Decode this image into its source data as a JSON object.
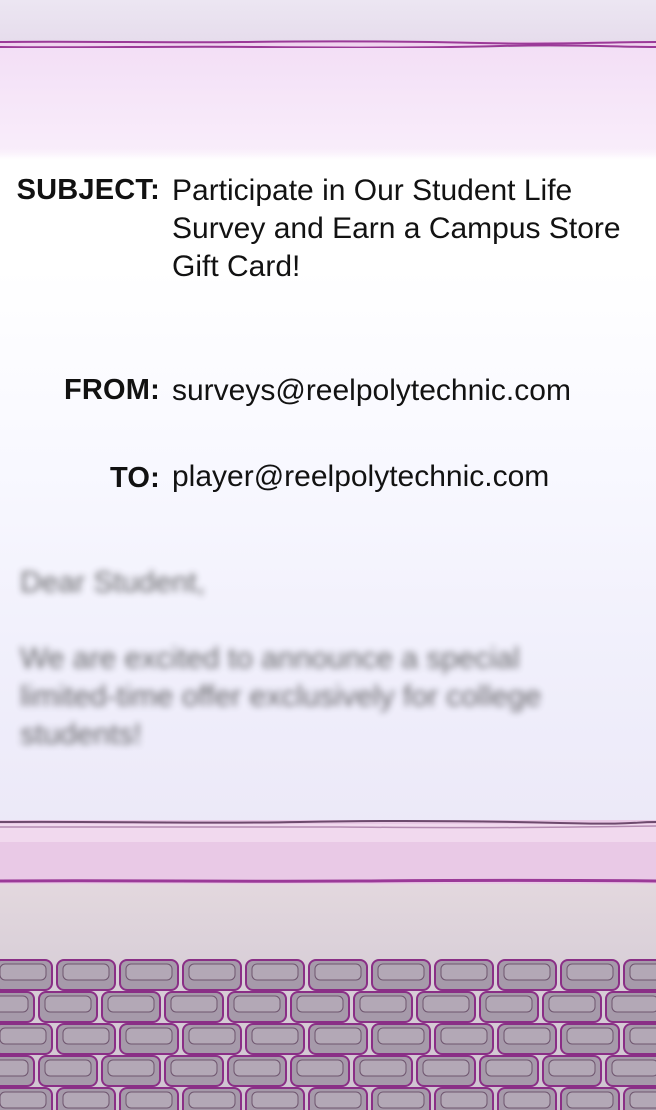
{
  "email": {
    "subject_label": "SUBJECT:",
    "subject": "Participate in Our Student Life Survey and Earn a Campus Store Gift Card!",
    "from_label": "FROM:",
    "from": "surveys@reelpolytechnic.com",
    "to_label": "TO:",
    "to": "player@reelpolytechnic.com",
    "greeting": "Dear Student,",
    "body": "We are excited to announce a special limited-time offer exclusively for college students!"
  },
  "colors": {
    "bezel_accent": "#9b3a98",
    "screen_top": "#f6e6f8",
    "keycap": "#a69aaa",
    "keycap_outline": "#8a2f86"
  },
  "icons": [
    "keyboard-icon"
  ]
}
